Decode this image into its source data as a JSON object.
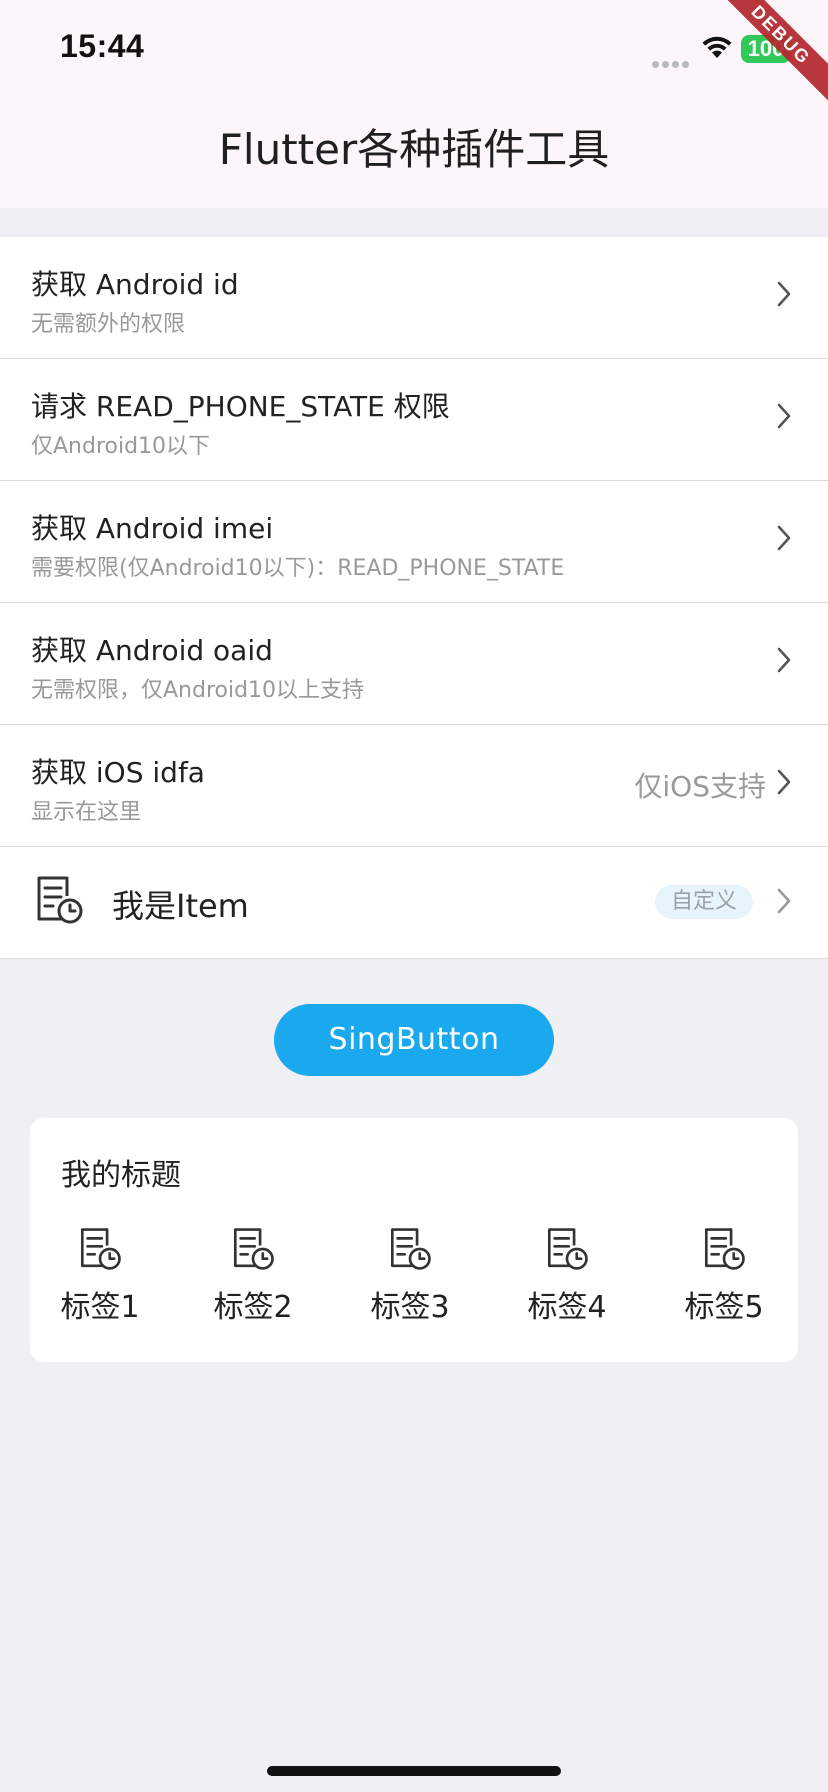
{
  "status_bar": {
    "time": "15:44",
    "battery": "100",
    "debug_ribbon": "DEBUG"
  },
  "app_bar": {
    "title": "Flutter各种插件工具"
  },
  "list": [
    {
      "title": "获取 Android id",
      "subtitle": "无需额外的权限",
      "value": ""
    },
    {
      "title": "请求 READ_PHONE_STATE 权限",
      "subtitle": "仅Android10以下",
      "value": ""
    },
    {
      "title": "获取 Android imei",
      "subtitle": "需要权限(仅Android10以下)：READ_PHONE_STATE",
      "value": ""
    },
    {
      "title": "获取 Android oaid",
      "subtitle": "无需权限，仅Android10以上支持",
      "value": ""
    },
    {
      "title": "获取 iOS idfa",
      "subtitle": "显示在这里",
      "value": "仅iOS支持"
    }
  ],
  "custom_item": {
    "icon": "document-clock-icon",
    "label": "我是Item",
    "badge": "自定义"
  },
  "button": {
    "label": "SingButton",
    "color": "#1aa9ee"
  },
  "card": {
    "title": "我的标题",
    "tags": [
      {
        "label": "标签1",
        "icon": "document-clock-icon"
      },
      {
        "label": "标签2",
        "icon": "document-clock-icon"
      },
      {
        "label": "标签3",
        "icon": "document-clock-icon"
      },
      {
        "label": "标签4",
        "icon": "document-clock-icon"
      },
      {
        "label": "标签5",
        "icon": "document-clock-icon"
      }
    ]
  }
}
